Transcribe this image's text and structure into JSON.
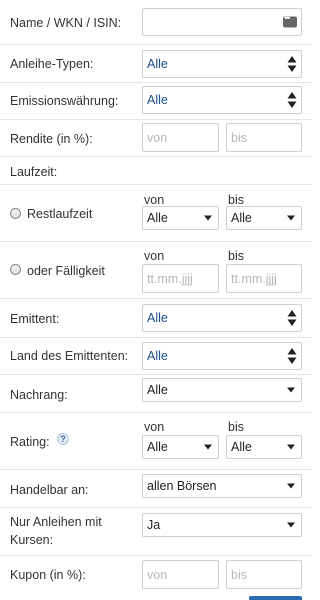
{
  "name_field": {
    "label": "Name / WKN / ISIN:",
    "value": ""
  },
  "anleihe_typen": {
    "label": "Anleihe-Typen:",
    "value": "Alle"
  },
  "emissionswaehrung": {
    "label": "Emissionswährung:",
    "value": "Alle"
  },
  "rendite": {
    "label": "Rendite (in %):",
    "from_placeholder": "von",
    "to_placeholder": "bis"
  },
  "laufzeit": {
    "label": "Laufzeit:"
  },
  "restlaufzeit": {
    "label": "Restlaufzeit",
    "from_label": "von",
    "to_label": "bis",
    "from_value": "Alle",
    "to_value": "Alle"
  },
  "faelligkeit": {
    "label": "oder Fälligkeit",
    "from_label": "von",
    "to_label": "bis",
    "from_placeholder": "tt.mm.jjjj",
    "to_placeholder": "tt.mm.jjjj"
  },
  "emittent": {
    "label": "Emittent:",
    "value": "Alle"
  },
  "land_emittent": {
    "label": "Land des Emittenten:",
    "value": "Alle"
  },
  "nachrang": {
    "label": "Nachrang:",
    "value": "Alle"
  },
  "rating": {
    "label": "Rating:",
    "help": "?",
    "from_label": "von",
    "to_label": "bis",
    "from_value": "Alle",
    "to_value": "Alle"
  },
  "handelbar": {
    "label": "Handelbar an:",
    "value": "allen Börsen"
  },
  "nur_kursen": {
    "label_line1": "Nur Anleihen mit",
    "label_line2": "Kursen:",
    "value": "Ja"
  },
  "kupon": {
    "label": "Kupon (in %):",
    "from_placeholder": "von",
    "to_placeholder": "bis"
  },
  "colors": {
    "link_blue": "#1a4f8b",
    "placeholder": "#b7b7b7",
    "border": "#cfcfcf"
  }
}
